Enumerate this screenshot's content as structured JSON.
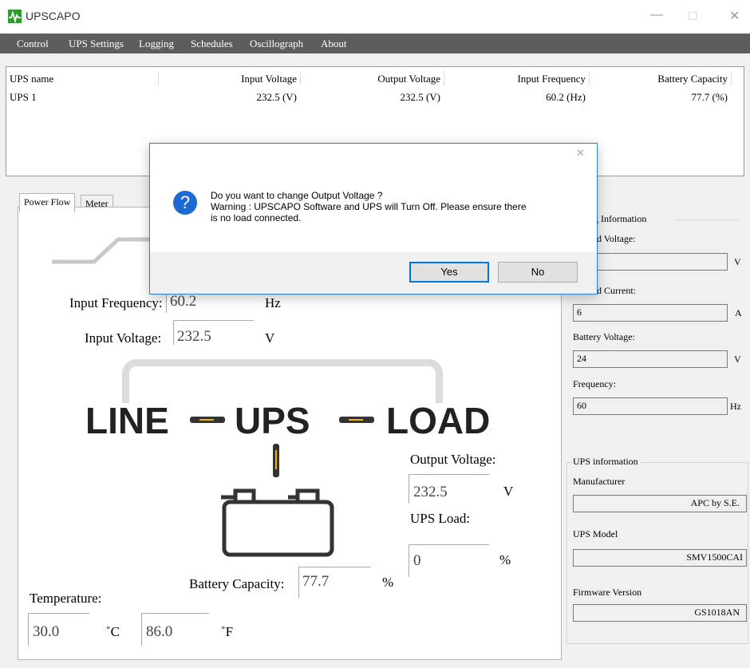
{
  "window": {
    "title": "UPSCAPO",
    "minimize": "—",
    "maximize": "☐",
    "close": "✕"
  },
  "menu": [
    "Control",
    "UPS Settings",
    "Logging",
    "Schedules",
    "Oscillograph",
    "About"
  ],
  "table": {
    "headers": [
      "UPS name",
      "Input Voltage",
      "Output Voltage",
      "Input Frequency",
      "Battery Capacity"
    ],
    "rows": [
      [
        "UPS 1",
        "232.5 (V)",
        "232.5 (V)",
        "60.2 (Hz)",
        "77.7 (%)"
      ]
    ]
  },
  "tabs": [
    "Power Flow",
    "Meter"
  ],
  "flow": {
    "line": "LINE",
    "ups": "UPS",
    "load": "LOAD",
    "input_frequency_label": "Input Frequency:",
    "input_frequency": "60.2",
    "hz": "Hz",
    "input_voltage_label": "Input Voltage:",
    "input_voltage": "232.5",
    "v": "V",
    "output_voltage_label": "Output Voltage:",
    "output_voltage": "232.5",
    "ups_load_label": "UPS Load:",
    "ups_load": "0",
    "pct": "%",
    "battery_capacity_label": "Battery Capacity:",
    "battery_capacity": "77.7",
    "temperature_label": "Temperature:",
    "temp_c": "30.0",
    "unit_c": "˚C",
    "temp_f": "86.0",
    "unit_f": "˚F"
  },
  "rating": {
    "title": "g Information",
    "rated_voltage_label": "d Voltage:",
    "rated_voltage": "",
    "v": "V",
    "rated_current_label": "d Current:",
    "rated_current": "6",
    "a": "A",
    "battery_voltage_label": "Battery Voltage:",
    "battery_voltage": "24",
    "frequency_label": "Frequency:",
    "frequency": "60",
    "hz": "Hz"
  },
  "ups_info": {
    "title": "UPS information",
    "manufacturer_label": "Manufacturer",
    "manufacturer": "APC by S.E.",
    "model_label": "UPS Model",
    "model": "SMV1500CAI",
    "firmware_label": "Firmware Version",
    "firmware": "GS1018AN"
  },
  "dialog": {
    "line1": "Do you want to change Output Voltage ?",
    "line2": "Warning : UPSCAPO Software and UPS will Turn Off. Please ensure there",
    "line3": "is no load connected.",
    "yes": "Yes",
    "no": "No",
    "close": "✕",
    "icon": "?"
  },
  "colors": {
    "menubar": "#5d5d5d",
    "accent": "#0078d7",
    "logo": "#2e9b2e",
    "arrow": "#e8b400"
  }
}
